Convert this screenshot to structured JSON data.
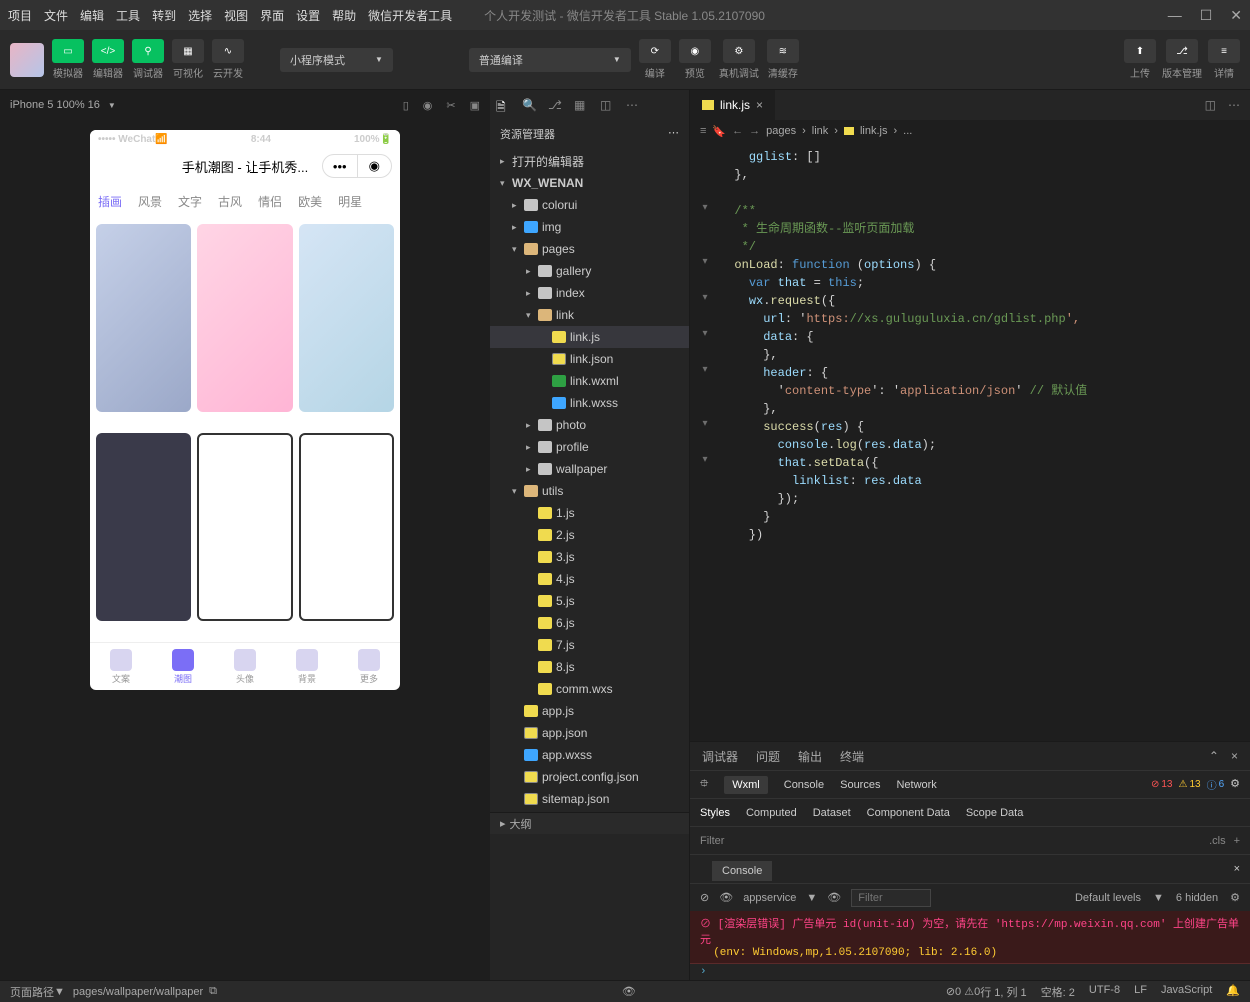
{
  "menubar": [
    "项目",
    "文件",
    "编辑",
    "工具",
    "转到",
    "选择",
    "视图",
    "界面",
    "设置",
    "帮助",
    "微信开发者工具"
  ],
  "window_title": "个人开发测试 - 微信开发者工具 Stable 1.05.2107090",
  "toolbar": {
    "tools": [
      "模拟器",
      "编辑器",
      "调试器",
      "可视化",
      "云开发"
    ],
    "mode": "小程序模式",
    "compile_mode": "普通编译",
    "actions": [
      "编译",
      "预览",
      "真机调试",
      "清缓存"
    ],
    "right_actions": [
      "上传",
      "版本管理",
      "详情"
    ]
  },
  "simulator": {
    "device": "iPhone 5 100% 16",
    "phone_time": "8:44",
    "phone_carrier": "••••• WeChat",
    "phone_battery": "100%",
    "app_title": "手机潮图 - 让手机秀...",
    "tabs": [
      "插画",
      "风景",
      "文字",
      "古风",
      "情侣",
      "欧美",
      "明星"
    ],
    "tabbar": [
      "文案",
      "潮图",
      "头像",
      "背景",
      "更多"
    ],
    "tabbar_active": 1
  },
  "explorer": {
    "title": "资源管理器",
    "tree": {
      "opened_editors": "打开的编辑器",
      "project": "WX_WENAN",
      "folders": {
        "colorui": "colorui",
        "img": "img",
        "pages": "pages",
        "gallery": "gallery",
        "index": "index",
        "link": "link",
        "photo": "photo",
        "profile": "profile",
        "wallpaper": "wallpaper",
        "utils": "utils"
      },
      "link_files": [
        "link.js",
        "link.json",
        "link.wxml",
        "link.wxss"
      ],
      "utils_files": [
        "1.js",
        "2.js",
        "3.js",
        "4.js",
        "5.js",
        "6.js",
        "7.js",
        "8.js",
        "comm.wxs"
      ],
      "root_files": [
        "app.js",
        "app.json",
        "app.wxss",
        "project.config.json",
        "sitemap.json"
      ]
    }
  },
  "editor": {
    "active_tab": "link.js",
    "breadcrumb": [
      "pages",
      "link",
      "link.js",
      "..."
    ],
    "code_lines": [
      "    gglist: []",
      "  },",
      "",
      "  /**",
      "   * 生命周期函数--监听页面加载",
      "   */",
      "  onLoad: function (options) {",
      "    var that = this;",
      "    wx.request({",
      "      url: 'https://xs.guluguluxia.cn/gdlist.php',",
      "      data: {",
      "      },",
      "      header: {",
      "        'content-type': 'application/json' // 默认值",
      "      },",
      "      success(res) {",
      "        console.log(res.data);",
      "        that.setData({",
      "          linklist: res.data",
      "        });",
      "      }",
      "    })"
    ]
  },
  "devtools": {
    "top_tabs": [
      "调试器",
      "问题",
      "输出",
      "终端"
    ],
    "panels": [
      "Wxml",
      "Console",
      "Sources",
      "Network"
    ],
    "active_panel": "Wxml",
    "badges": {
      "error": "13",
      "warn": "13",
      "info": "6"
    },
    "style_tabs": [
      "Styles",
      "Computed",
      "Dataset",
      "Component Data",
      "Scope Data"
    ],
    "filter_placeholder": "Filter",
    "cls_label": ".cls"
  },
  "console": {
    "tab": "Console",
    "context": "appservice",
    "levels": "Default levels",
    "hidden": "6 hidden",
    "error_line1": "[渲染层错误] 广告单元 id(unit-id) 为空，请先在 'https://mp.weixin.qq.com' 上创建广告单元",
    "error_line2": "(env: Windows,mp,1.05.2107090; lib: 2.16.0)"
  },
  "outline_label": "大纲",
  "statusbar": {
    "path_label": "页面路径",
    "path": "pages/wallpaper/wallpaper",
    "warnings": "0",
    "errors": "0",
    "cursor": "行 1, 列 1",
    "spaces": "空格: 2",
    "encoding": "UTF-8",
    "eol": "LF",
    "lang": "JavaScript"
  }
}
